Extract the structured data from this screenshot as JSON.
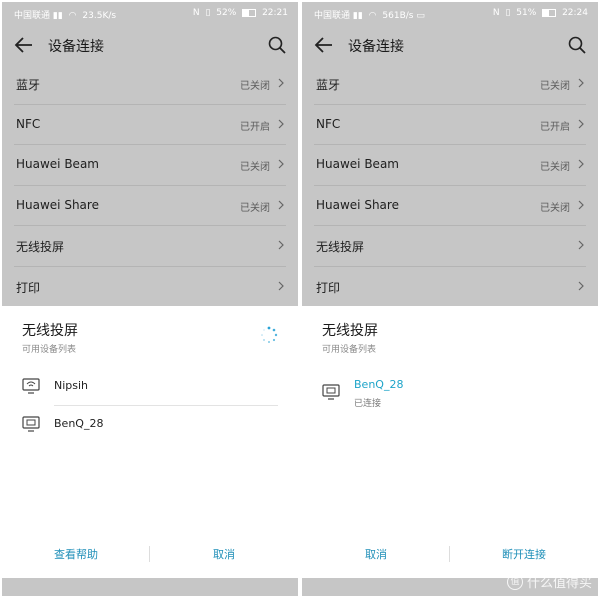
{
  "panels": [
    {
      "status": {
        "carrier": "中国联通",
        "net_speed": "23.5K/s",
        "battery": "52%",
        "battery_level": 0.52,
        "time": "22:21"
      },
      "appbar": {
        "title": "设备连接"
      },
      "settings": [
        {
          "label": "蓝牙",
          "status": "已关闭"
        },
        {
          "label": "NFC",
          "status": "已开启"
        },
        {
          "label": "Huawei Beam",
          "status": "已关闭"
        },
        {
          "label": "Huawei Share",
          "status": "已关闭"
        },
        {
          "label": "无线投屏",
          "status": ""
        },
        {
          "label": "打印",
          "status": ""
        }
      ],
      "dialog": {
        "title": "无线投屏",
        "subtitle": "可用设备列表",
        "devices": [
          {
            "name": "Nipsih",
            "icon": "wifi-display-icon",
            "state": ""
          },
          {
            "name": "BenQ_28",
            "icon": "monitor-icon",
            "state": ""
          }
        ],
        "buttons": [
          "查看帮助",
          "取消"
        ]
      }
    },
    {
      "status": {
        "carrier": "中国联通",
        "net_speed": "561B/s",
        "battery": "51%",
        "battery_level": 0.51,
        "time": "22:24"
      },
      "appbar": {
        "title": "设备连接"
      },
      "settings": [
        {
          "label": "蓝牙",
          "status": "已关闭"
        },
        {
          "label": "NFC",
          "status": "已开启"
        },
        {
          "label": "Huawei Beam",
          "status": "已关闭"
        },
        {
          "label": "Huawei Share",
          "status": "已关闭"
        },
        {
          "label": "无线投屏",
          "status": ""
        },
        {
          "label": "打印",
          "status": ""
        }
      ],
      "dialog": {
        "title": "无线投屏",
        "subtitle": "可用设备列表",
        "devices": [
          {
            "name": "BenQ_28",
            "icon": "monitor-icon",
            "state": "已连接"
          }
        ],
        "buttons": [
          "取消",
          "断开连接"
        ]
      }
    }
  ],
  "watermark": {
    "text": "什么值得买",
    "icon_glyph": "值"
  },
  "colors": {
    "dim_overlay": "#c6c6c6",
    "accent": "#1f8fb8",
    "connected": "#1ea4c9"
  }
}
